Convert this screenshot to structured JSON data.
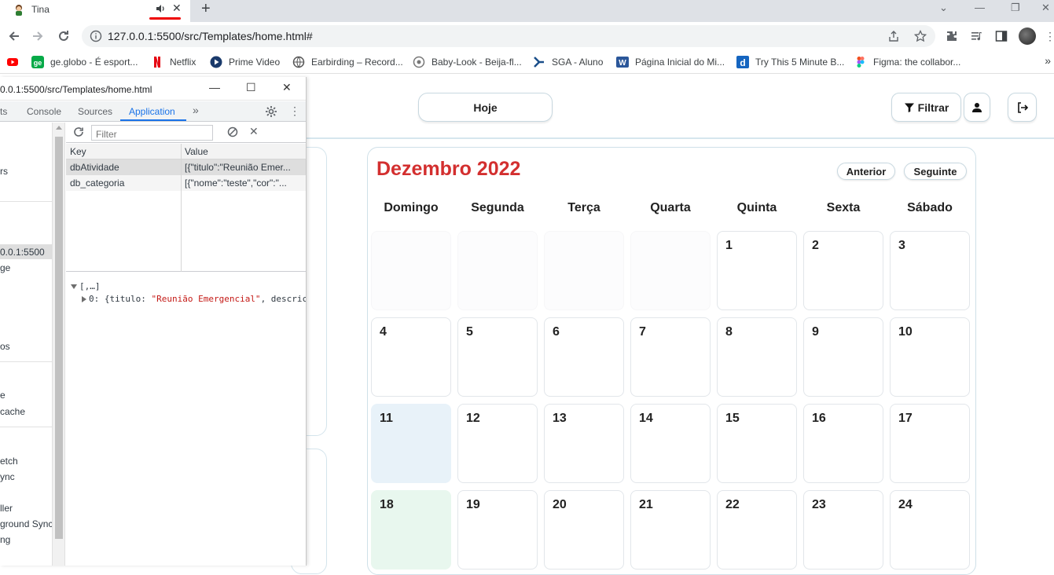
{
  "browser": {
    "tab_title": "Tina",
    "tab_close": "✕",
    "new_tab": "+",
    "url": "127.0.0.1:5500/src/Templates/home.html#",
    "window_controls": [
      "⌄",
      "—",
      "❐",
      "✕"
    ],
    "bookmarks": [
      {
        "label": "",
        "icon": "youtube-icon"
      },
      {
        "label": "ge.globo - É esport...",
        "icon": "ge-icon"
      },
      {
        "label": "Netflix",
        "icon": "netflix-icon"
      },
      {
        "label": "Prime Video",
        "icon": "prime-video-icon"
      },
      {
        "label": "Earbirding – Record...",
        "icon": "earbirding-icon"
      },
      {
        "label": "Baby-Look - Beija-fl...",
        "icon": "baby-look-icon"
      },
      {
        "label": "SGA - Aluno",
        "icon": "sga-icon"
      },
      {
        "label": "Página Inicial do Mi...",
        "icon": "word-icon"
      },
      {
        "label": "Try This 5 Minute B...",
        "icon": "d-icon"
      },
      {
        "label": "Figma: the collabor...",
        "icon": "figma-icon"
      }
    ],
    "bookmarks_more": "»"
  },
  "devtools": {
    "window_title": "0.0.1:5500/src/Templates/home.html",
    "tabs": [
      "ts",
      "Console",
      "Sources",
      "Application"
    ],
    "more_tabs": "»",
    "active_tab": "Application",
    "sidebar_items": [
      "rs",
      "0.0.1:5500",
      "ge",
      "os",
      "e",
      "cache",
      "etch",
      "ync",
      "ller",
      "ground Sync",
      "ng"
    ],
    "filter_placeholder": "Filter",
    "columns": {
      "key": "Key",
      "value": "Value"
    },
    "rows": [
      {
        "key": "dbAtividade",
        "value": "[{\"titulo\":\"Reunião Emer..."
      },
      {
        "key": "db_categoria",
        "value": "[{\"nome\":\"teste\",\"cor\":\"..."
      }
    ],
    "preview": {
      "line1": "[,…]",
      "line2_prefix": "0: {titulo: ",
      "line2_string": "\"Reunião Emergencial\"",
      "line2_suffix": ", descric"
    }
  },
  "app": {
    "hoje_label": "Hoje",
    "filtrar_label": "Filtrar",
    "calendar": {
      "title": "Dezembro 2022",
      "prev_label": "Anterior",
      "next_label": "Seguinte",
      "weekdays": [
        "Domingo",
        "Segunda",
        "Terça",
        "Quarta",
        "Quinta",
        "Sexta",
        "Sábado"
      ],
      "weeks": [
        [
          "",
          "",
          "",
          "",
          "1",
          "2",
          "3"
        ],
        [
          "4",
          "5",
          "6",
          "7",
          "8",
          "9",
          "10"
        ],
        [
          "11",
          "12",
          "13",
          "14",
          "15",
          "16",
          "17"
        ],
        [
          "18",
          "19",
          "20",
          "21",
          "22",
          "23",
          "24"
        ]
      ],
      "today": "11",
      "selected": "18",
      "title_color": "#d32f2f"
    }
  }
}
